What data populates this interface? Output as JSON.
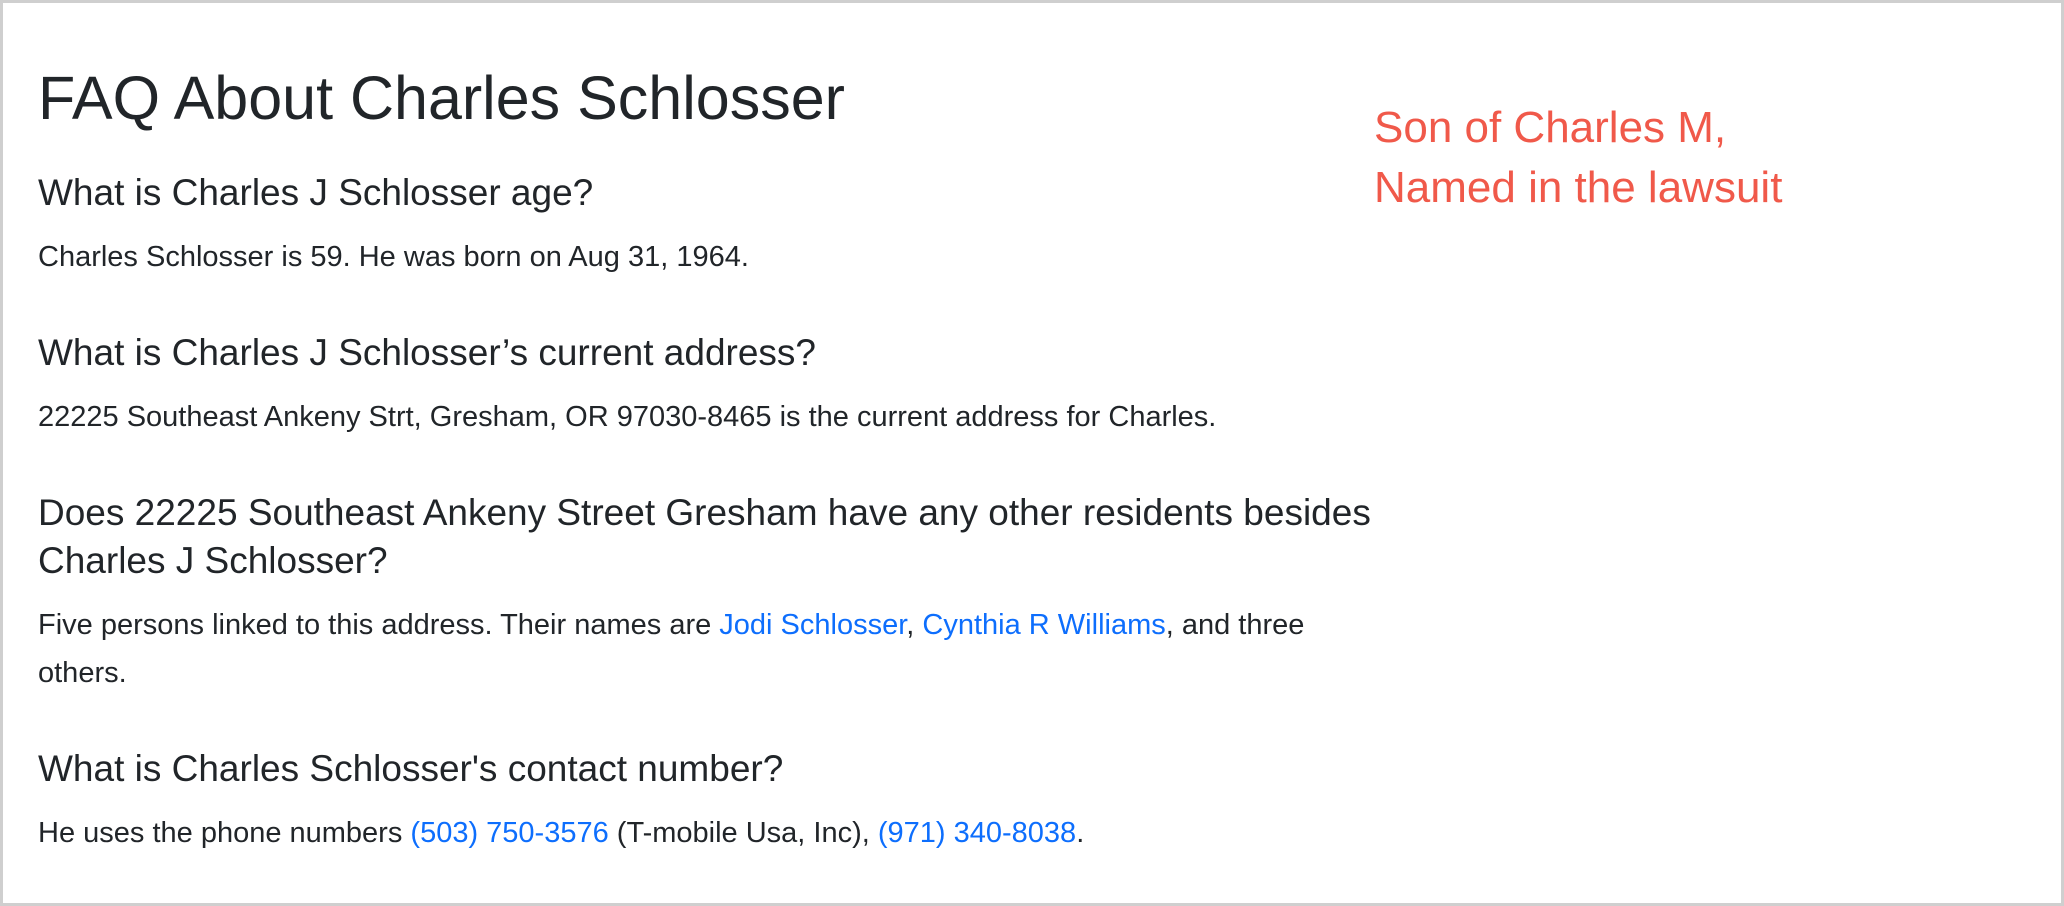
{
  "page": {
    "title": "FAQ About Charles Schlosser"
  },
  "faq": [
    {
      "question": "What is Charles J Schlosser age?",
      "answer": "Charles Schlosser is 59. He was born on Aug 31, 1964."
    },
    {
      "question": "What is Charles J Schlosser’s current address?",
      "answer": "22225 Southeast Ankeny Strt, Gresham, OR 97030-8465 is the current address for Charles."
    },
    {
      "question_line1": "Does 22225 Southeast Ankeny Street Gresham have any other residents besides",
      "question_line2": "Charles J Schlosser?",
      "answer_prefix": "Five persons linked to this address. Their names are ",
      "link1": "Jodi Schlosser",
      "sep": ", ",
      "link2": "Cynthia R Williams",
      "answer_suffix_line1": ", and three",
      "answer_line2": "others."
    },
    {
      "question": "What is Charles Schlosser's contact number?",
      "answer_prefix": "He uses the phone numbers ",
      "phone1": "(503) 750-3576",
      "middle": " (T-mobile Usa, Inc), ",
      "phone2": "(971) 340-8038",
      "end": "."
    }
  ],
  "annotation": {
    "line1": "Son of Charles M,",
    "line2": "Named in the lawsuit",
    "color": "#f0594a"
  },
  "colors": {
    "text": "#212529",
    "link": "#0d6efd",
    "border": "#cfcfcf"
  }
}
